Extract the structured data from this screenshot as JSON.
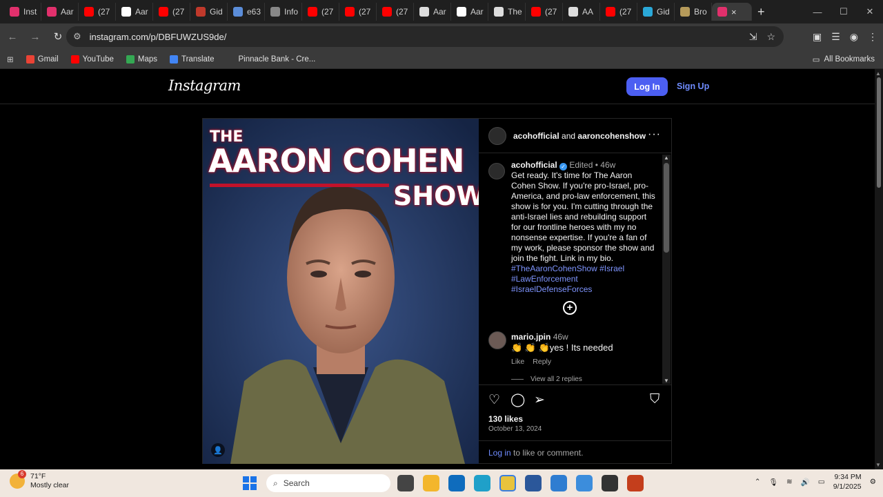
{
  "browser": {
    "tabs": [
      {
        "label": "Inst",
        "color": "#e1306c"
      },
      {
        "label": "Aar",
        "color": "#e1306c"
      },
      {
        "label": "(27",
        "color": "#ff0000"
      },
      {
        "label": "Aar",
        "color": "#ffffff"
      },
      {
        "label": "(27",
        "color": "#ff0000"
      },
      {
        "label": "Gid",
        "color": "#c0392b"
      },
      {
        "label": "e63",
        "color": "#5b8dd9"
      },
      {
        "label": "Info",
        "color": "#888888"
      },
      {
        "label": "(27",
        "color": "#ff0000"
      },
      {
        "label": "(27",
        "color": "#ff0000"
      },
      {
        "label": "(27",
        "color": "#ff0000"
      },
      {
        "label": "Aar",
        "color": "#dddddd"
      },
      {
        "label": "Aar",
        "color": "#ffffff"
      },
      {
        "label": "The",
        "color": "#dddddd"
      },
      {
        "label": "(27",
        "color": "#ff0000"
      },
      {
        "label": "AA",
        "color": "#dddddd"
      },
      {
        "label": "(27",
        "color": "#ff0000"
      },
      {
        "label": "Gid",
        "color": "#2aa8d8"
      },
      {
        "label": "Bro",
        "color": "#b59a5a"
      }
    ],
    "active_tab_close": "×",
    "new_tab": "+",
    "url": "instagram.com/p/DBFUWZUS9de/",
    "bookmarks": [
      {
        "label": "Gmail",
        "color": "#ea4335"
      },
      {
        "label": "YouTube",
        "color": "#ff0000"
      },
      {
        "label": "Maps",
        "color": "#34a853"
      },
      {
        "label": "Translate",
        "color": "#4285f4"
      },
      {
        "label": "Pinnacle Bank - Cre...",
        "color": "#3a3a3a"
      }
    ],
    "all_bookmarks": "All Bookmarks"
  },
  "instagram": {
    "logo": "Instagram",
    "login": "Log In",
    "signup": "Sign Up",
    "post": {
      "image_text": {
        "the": "THE",
        "main": "AARON COHEN",
        "show": "SHOW"
      },
      "header_user1": "acohofficial",
      "header_and": "and",
      "header_user2": "aaroncohenshow",
      "more": "···",
      "caption_user": "acohofficial",
      "edited": "Edited",
      "dot": "•",
      "caption_age": "46w",
      "caption_text": "Get ready. It's time for The Aaron Cohen Show. If you're pro-Israel, pro-America, and pro-law enforcement, this show is for you. I'm cutting through the anti-Israel lies and rebuilding support for our frontline heroes with my no nonsense expertise. If you're a fan of my work, please sponsor the show and join the fight. Link in my bio.",
      "hashtags": "#TheAaronCohenShow #Israel #LawEnforcement #IsraelDefenseForces",
      "comment": {
        "user": "mario.jpin",
        "age": "46w",
        "text": "👏 👏 👏yes ! Its needed",
        "like": "Like",
        "reply": "Reply",
        "view_replies": "View all 2 replies"
      },
      "likes": "130 likes",
      "date": "October 13, 2024",
      "login_link": "Log in",
      "login_suffix": " to like or comment."
    }
  },
  "taskbar": {
    "temp": "71°F",
    "condition": "Mostly clear",
    "weather_badge": "6",
    "search_placeholder": "Search",
    "time": "9:34 PM",
    "date": "9/1/2025"
  }
}
